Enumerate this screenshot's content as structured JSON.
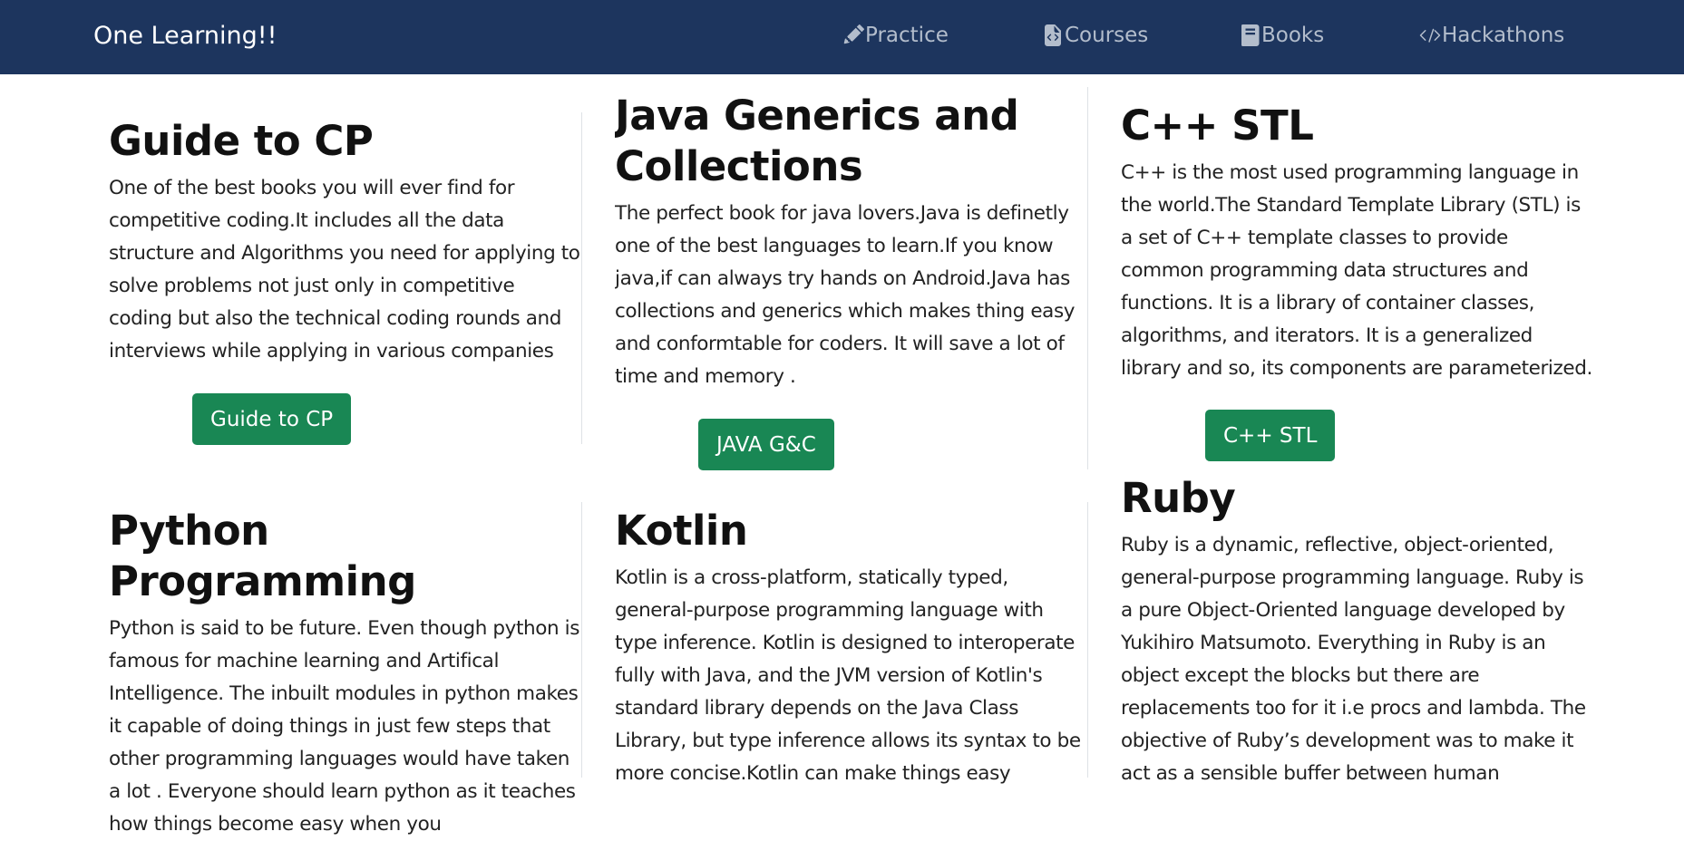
{
  "navbar": {
    "brand": "One Learning!!",
    "links": [
      {
        "label": "Practice",
        "icon": "pencil-icon"
      },
      {
        "label": "Courses",
        "icon": "file-code-icon"
      },
      {
        "label": "Books",
        "icon": "book-icon"
      },
      {
        "label": "Hackathons",
        "icon": "code-slash-icon"
      }
    ],
    "bg_color": "#1d355e"
  },
  "cards": [
    {
      "title": "Guide to CP",
      "text": "One of the best books you will ever find for competitive coding.It includes all the data structure and Algorithms you need for applying to solve problems not just only in competitive coding but also the technical coding rounds and interviews while applying in various companies",
      "button": "Guide to CP"
    },
    {
      "title": "Java Generics and Collections",
      "text": "The perfect book for java lovers.Java is definetly one of the best languages to learn.If you know java,if can always try hands on Android.Java has collections and generics which makes thing easy and conformtable for coders. It will save a lot of time and memory .",
      "button": "JAVA G&C"
    },
    {
      "title": "C++ STL",
      "text": "C++ is the most used programming language in the world.The Standard Template Library (STL) is a set of C++ template classes to provide common programming data structures and functions. It is a library of container classes, algorithms, and iterators. It is a generalized library and so, its components are parameterized.",
      "button": "C++ STL"
    },
    {
      "title": "Python Programming",
      "text": "Python is said to be future. Even though python is famous for machine learning and Artifical Intelligence. The inbuilt modules in python makes it capable of doing things in just few steps that other programming languages would have taken a lot . Everyone should learn python as it teaches how things become easy when you"
    },
    {
      "title": "Kotlin",
      "text": "Kotlin is a cross-platform, statically typed, general-purpose programming language with type inference. Kotlin is designed to interoperate fully with Java, and the JVM version of Kotlin's standard library depends on the Java Class Library, but type inference allows its syntax to be more concise.Kotlin can make things easy"
    },
    {
      "title": "Ruby",
      "text": "Ruby is a dynamic, reflective, object-oriented, general-purpose programming language. Ruby is a pure Object-Oriented language developed by Yukihiro Matsumoto. Everything in Ruby is an object except the blocks but there are replacements too for it i.e procs and lambda. The objective of Ruby’s development was to make it act as a sensible buffer between human"
    }
  ],
  "colors": {
    "button": "#198754",
    "divider": "#dee2e6"
  }
}
